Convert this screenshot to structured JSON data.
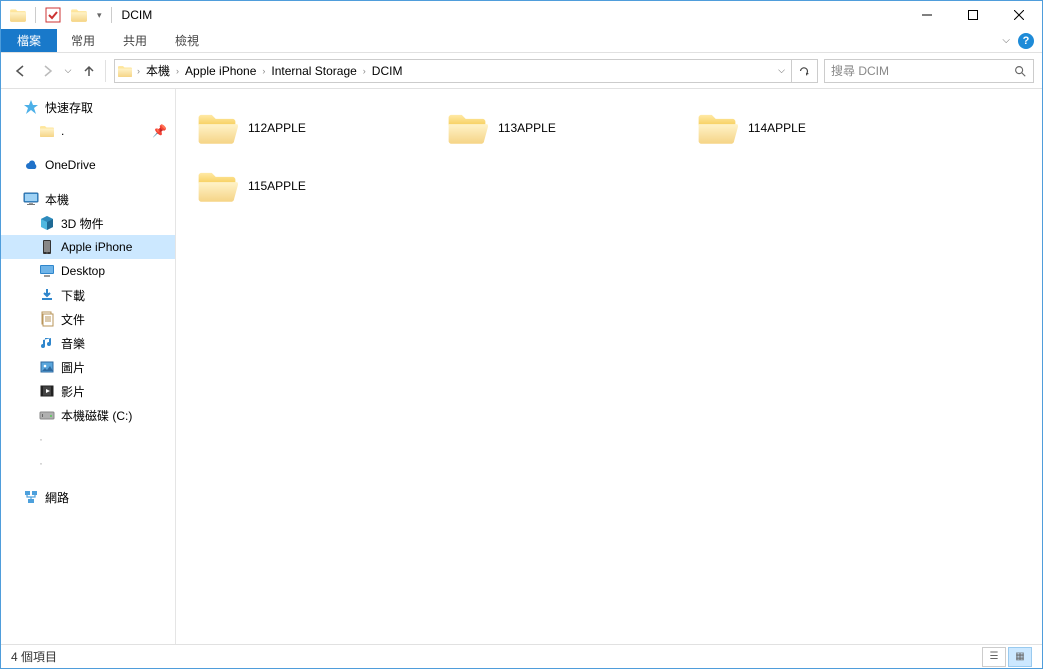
{
  "window": {
    "title": "DCIM"
  },
  "ribbon": {
    "file": "檔案",
    "tabs": [
      "常用",
      "共用",
      "檢視"
    ]
  },
  "breadcrumb": [
    "本機",
    "Apple iPhone",
    "Internal Storage",
    "DCIM"
  ],
  "search": {
    "placeholder": "搜尋 DCIM"
  },
  "sidebar": {
    "quick_access": "快速存取",
    "pinned": ".",
    "onedrive": "OneDrive",
    "this_pc": "本機",
    "children": [
      {
        "label": "3D 物件",
        "icon": "cube"
      },
      {
        "label": "Apple iPhone",
        "icon": "phone",
        "selected": true
      },
      {
        "label": "Desktop",
        "icon": "desktop"
      },
      {
        "label": "下載",
        "icon": "download"
      },
      {
        "label": "文件",
        "icon": "docs"
      },
      {
        "label": "音樂",
        "icon": "music"
      },
      {
        "label": "圖片",
        "icon": "pictures"
      },
      {
        "label": "影片",
        "icon": "videos"
      },
      {
        "label": "本機磁碟 (C:)",
        "icon": "drive"
      }
    ],
    "network": "網路"
  },
  "folders": [
    "112APPLE",
    "113APPLE",
    "114APPLE",
    "115APPLE"
  ],
  "status": {
    "count": "4 個項目"
  }
}
